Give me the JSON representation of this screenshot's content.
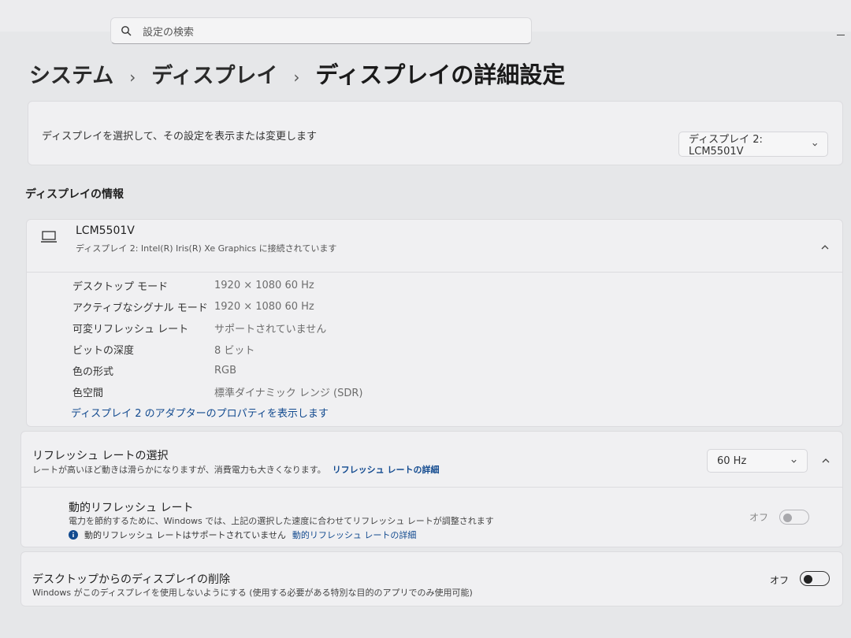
{
  "search": {
    "placeholder": "設定の検索"
  },
  "breadcrumb": {
    "items": [
      "システム",
      "ディスプレイ",
      "ディスプレイの詳細設定"
    ]
  },
  "display_select": {
    "description": "ディスプレイを選択して、その設定を表示または変更します",
    "selected": "ディスプレイ 2: LCM5501V"
  },
  "display_info": {
    "section_title": "ディスプレイの情報",
    "monitor_name": "LCM5501V",
    "monitor_sub": "ディスプレイ 2: Intel(R) Iris(R) Xe Graphics に接続されています",
    "specs": [
      {
        "label": "デスクトップ モード",
        "value": "1920 × 1080 60 Hz"
      },
      {
        "label": "アクティブなシグナル モード",
        "value": "1920 × 1080 60 Hz"
      },
      {
        "label": "可変リフレッシュ レート",
        "value": "サポートされていません"
      },
      {
        "label": "ビットの深度",
        "value": "8 ビット"
      },
      {
        "label": "色の形式",
        "value": "RGB"
      },
      {
        "label": "色空間",
        "value": "標準ダイナミック レンジ (SDR)"
      }
    ],
    "adapter_link": "ディスプレイ 2 のアダプターのプロパティを表示します"
  },
  "refresh_rate": {
    "title": "リフレッシュ レートの選択",
    "subtitle": "レートが高いほど動きは滑らかになりますが、消費電力も大きくなります。",
    "subtitle_link": "リフレッシュ レートの詳細",
    "selected": "60 Hz",
    "dynamic": {
      "title": "動的リフレッシュ レート",
      "subtitle": "電力を節約するために、Windows では、上記の選択した速度に合わせてリフレッシュ レートが調整されます",
      "note": "動的リフレッシュ レートはサポートされていません",
      "note_link": "動的リフレッシュ レートの詳細",
      "toggle_label": "オフ"
    }
  },
  "remove_display": {
    "title": "デスクトップからのディスプレイの削除",
    "subtitle": "Windows がこのディスプレイを使用しないようにする (使用する必要がある特別な目的のアプリでのみ使用可能)",
    "toggle_label": "オフ"
  },
  "colors": {
    "link": "#124a8f",
    "background": "#e6e7e9",
    "card": "#f0f0f2"
  }
}
